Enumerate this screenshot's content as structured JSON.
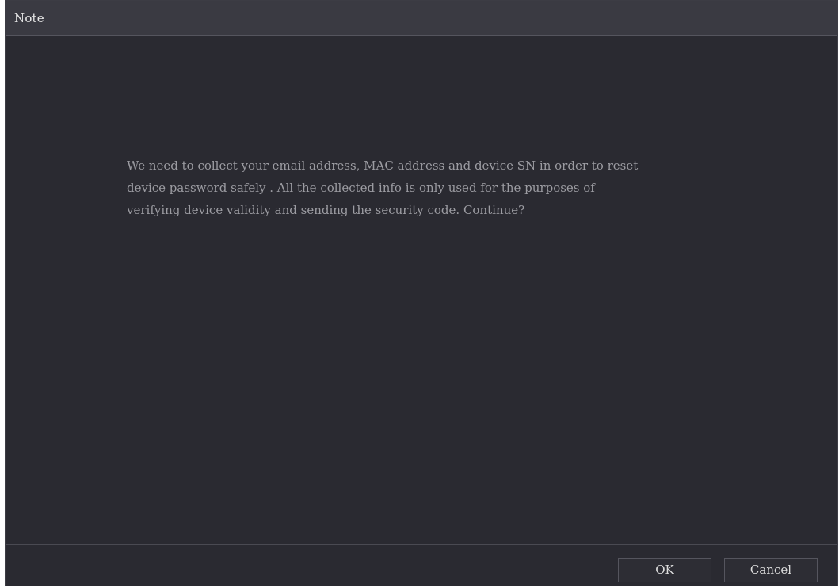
{
  "dialog": {
    "title": "Note",
    "message_lines": [
      "We need to collect your email address, MAC address and device SN in order to reset",
      "device password safely . All the collected info is only used for the purposes of",
      "verifying device validity and sending the security code. Continue?"
    ],
    "buttons": {
      "ok_label": "OK",
      "cancel_label": "Cancel"
    }
  },
  "colors": {
    "background": "#2a2a31",
    "titlebar": "#3a3a42",
    "text": "#9c9ca2"
  }
}
